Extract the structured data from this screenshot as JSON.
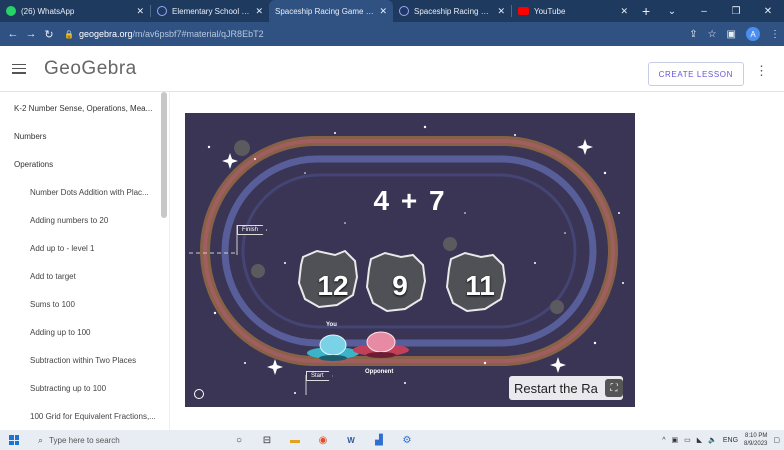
{
  "browser": {
    "tabs": [
      {
        "title": "(26) WhatsApp",
        "icon": "whatsapp-icon",
        "icon_color": "#25d366",
        "active": false
      },
      {
        "title": "Elementary School Math: 30",
        "icon": "geogebra-icon",
        "icon_color": "#9aa6ff",
        "active": false
      },
      {
        "title": "Spaceship Racing Game – G",
        "icon": "geogebra-icon",
        "icon_color": "#9aa6ff",
        "active": true
      },
      {
        "title": "Spaceship Racing Game – G",
        "icon": "geogebra-icon",
        "icon_color": "#9aa6ff",
        "active": false
      },
      {
        "title": "YouTube",
        "icon": "youtube-icon",
        "icon_color": "#ff0000",
        "active": false
      }
    ],
    "url_host": "geogebra.org",
    "url_path": "/m/av6psbf7#material/qJR8EbT2"
  },
  "app": {
    "logo": "GeoGebra",
    "create_lesson": "CREATE LESSON",
    "accent_color": "#6557d2"
  },
  "sidebar": {
    "items": [
      {
        "label": "K-2 Number Sense, Operations, Mea...",
        "level": 1
      },
      {
        "label": "Numbers",
        "level": 1
      },
      {
        "label": "Operations",
        "level": 1
      },
      {
        "label": "Number Dots Addition with Plac...",
        "level": 2
      },
      {
        "label": "Adding numbers to 20",
        "level": 2
      },
      {
        "label": "Add up to - level 1",
        "level": 2
      },
      {
        "label": "Add to target",
        "level": 2
      },
      {
        "label": "Sums to 100",
        "level": 2
      },
      {
        "label": "Adding up to 100",
        "level": 2
      },
      {
        "label": "Subtraction within Two Places",
        "level": 2
      },
      {
        "label": "Subtracting up to 100",
        "level": 2
      },
      {
        "label": "100 Grid for Equivalent Fractions,...",
        "level": 2
      }
    ]
  },
  "game": {
    "problem": "4 + 7",
    "answers": [
      "12",
      "9",
      "11"
    ],
    "player_label": "You",
    "opponent_label": "Opponent",
    "finish_label": "Finish",
    "start_label": "Start",
    "restart_label": "Restart the Ra",
    "background_color": "#3a3554"
  },
  "taskbar": {
    "search_placeholder": "Type here to search",
    "language": "ENG",
    "time": "8:10 PM",
    "date": "8/9/2023"
  }
}
